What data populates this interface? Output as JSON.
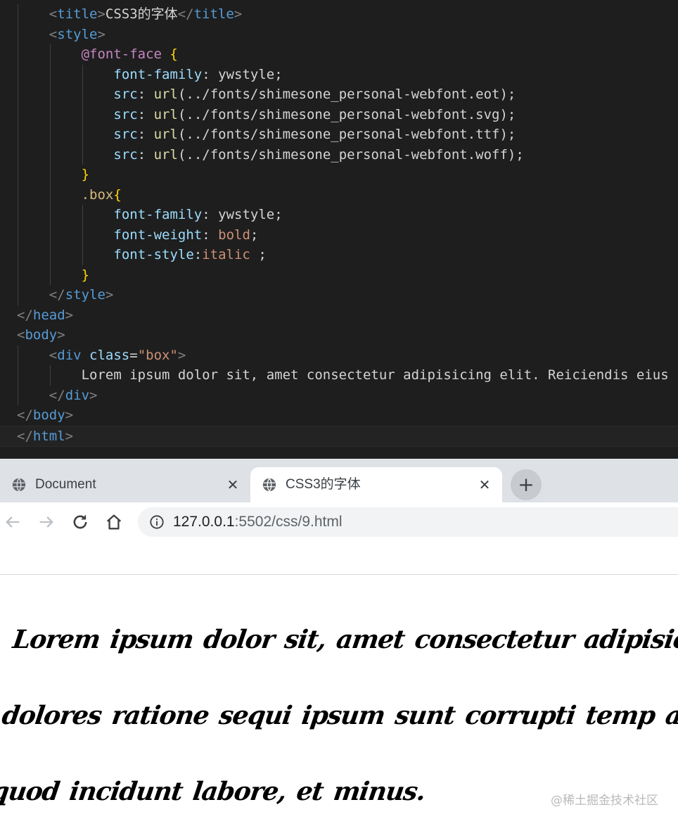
{
  "editor": {
    "lines": [
      {
        "indent": 4,
        "tokens": [
          [
            "punc",
            "<"
          ],
          [
            "tag",
            "title"
          ],
          [
            "punc",
            ">"
          ],
          [
            "text",
            "CSS3的字体"
          ],
          [
            "punc",
            "</"
          ],
          [
            "tag",
            "title"
          ],
          [
            "punc",
            ">"
          ]
        ]
      },
      {
        "indent": 4,
        "tokens": [
          [
            "punc",
            "<"
          ],
          [
            "tag",
            "style"
          ],
          [
            "punc",
            ">"
          ]
        ]
      },
      {
        "indent": 8,
        "tokens": [
          [
            "at",
            "@font-face"
          ],
          [
            "text",
            " {"
          ]
        ]
      },
      {
        "indent": 12,
        "tokens": [
          [
            "prop",
            "font-family"
          ],
          [
            "text",
            ": "
          ],
          [
            "val",
            "ywstyle"
          ],
          [
            "text",
            ";"
          ]
        ]
      },
      {
        "indent": 12,
        "tokens": [
          [
            "prop",
            "src"
          ],
          [
            "text",
            ": "
          ],
          [
            "func",
            "url"
          ],
          [
            "text",
            "(../fonts/shimesone_personal-webfont.eot);"
          ]
        ]
      },
      {
        "indent": 12,
        "tokens": [
          [
            "prop",
            "src"
          ],
          [
            "text",
            ": "
          ],
          [
            "func",
            "url"
          ],
          [
            "text",
            "(../fonts/shimesone_personal-webfont.svg);"
          ]
        ]
      },
      {
        "indent": 12,
        "tokens": [
          [
            "prop",
            "src"
          ],
          [
            "text",
            ": "
          ],
          [
            "func",
            "url"
          ],
          [
            "text",
            "(../fonts/shimesone_personal-webfont.ttf);"
          ]
        ]
      },
      {
        "indent": 12,
        "tokens": [
          [
            "prop",
            "src"
          ],
          [
            "text",
            ": "
          ],
          [
            "func",
            "url"
          ],
          [
            "text",
            "(../fonts/shimesone_personal-webfont.woff);"
          ]
        ]
      },
      {
        "indent": 8,
        "tokens": [
          [
            "text",
            "}"
          ]
        ]
      },
      {
        "indent": 8,
        "tokens": [
          [
            "sel",
            ".box"
          ],
          [
            "text",
            "{"
          ]
        ]
      },
      {
        "indent": 12,
        "tokens": [
          [
            "prop",
            "font-family"
          ],
          [
            "text",
            ": "
          ],
          [
            "val",
            "ywstyle"
          ],
          [
            "text",
            ";"
          ]
        ]
      },
      {
        "indent": 12,
        "tokens": [
          [
            "prop",
            "font-weight"
          ],
          [
            "text",
            ": "
          ],
          [
            "valk",
            "bold"
          ],
          [
            "text",
            ";"
          ]
        ]
      },
      {
        "indent": 12,
        "tokens": [
          [
            "prop",
            "font-style"
          ],
          [
            "text",
            ":"
          ],
          [
            "valk",
            "italic"
          ],
          [
            "text",
            " ;"
          ]
        ]
      },
      {
        "indent": 8,
        "tokens": [
          [
            "text",
            "}"
          ]
        ]
      },
      {
        "indent": 4,
        "tokens": [
          [
            "punc",
            "</"
          ],
          [
            "tag",
            "style"
          ],
          [
            "punc",
            ">"
          ]
        ]
      },
      {
        "indent": 0,
        "tokens": [
          [
            "punc",
            "</"
          ],
          [
            "tag",
            "head"
          ],
          [
            "punc",
            ">"
          ]
        ]
      },
      {
        "indent": 0,
        "tokens": [
          [
            "punc",
            "<"
          ],
          [
            "tag",
            "body"
          ],
          [
            "punc",
            ">"
          ]
        ]
      },
      {
        "indent": 4,
        "tokens": [
          [
            "punc",
            "<"
          ],
          [
            "tag",
            "div"
          ],
          [
            "text",
            " "
          ],
          [
            "attr",
            "class"
          ],
          [
            "text",
            "="
          ],
          [
            "str",
            "\"box\""
          ],
          [
            "punc",
            ">"
          ]
        ]
      },
      {
        "indent": 8,
        "tokens": [
          [
            "text",
            "Lorem ipsum dolor sit, amet consectetur adipisicing elit. Reiciendis eius"
          ]
        ]
      },
      {
        "indent": 4,
        "tokens": [
          [
            "punc",
            "</"
          ],
          [
            "tag",
            "div"
          ],
          [
            "punc",
            ">"
          ]
        ]
      },
      {
        "indent": 0,
        "tokens": [
          [
            "punc",
            "</"
          ],
          [
            "tag",
            "body"
          ],
          [
            "punc",
            ">"
          ]
        ]
      },
      {
        "indent": 0,
        "tokens": [
          [
            "punc",
            "</"
          ],
          [
            "tag",
            "html"
          ],
          [
            "punc",
            ">"
          ]
        ]
      }
    ]
  },
  "browser": {
    "tabs": [
      {
        "title": "Document",
        "active": false,
        "close": "✕"
      },
      {
        "title": "CSS3的字体",
        "active": true,
        "close": "✕"
      }
    ],
    "new_tab": "+",
    "address": {
      "host": "127.0.0.1",
      "path": ":5502/css/9.html"
    }
  },
  "page": {
    "box_text": "Lorem ipsum dolor sit, amet consectetur adipisicing el cumque dolores ratione sequi ipsum sunt corrupti temp autem, neque quod incidunt labore, et minus."
  },
  "watermark": "@稀土掘金技术社区",
  "icons": {
    "tab_favicon": "globe-icon",
    "back": "arrow-left-icon",
    "forward": "arrow-right-icon",
    "reload": "reload-icon",
    "home": "home-icon",
    "site_info": "info-icon"
  }
}
